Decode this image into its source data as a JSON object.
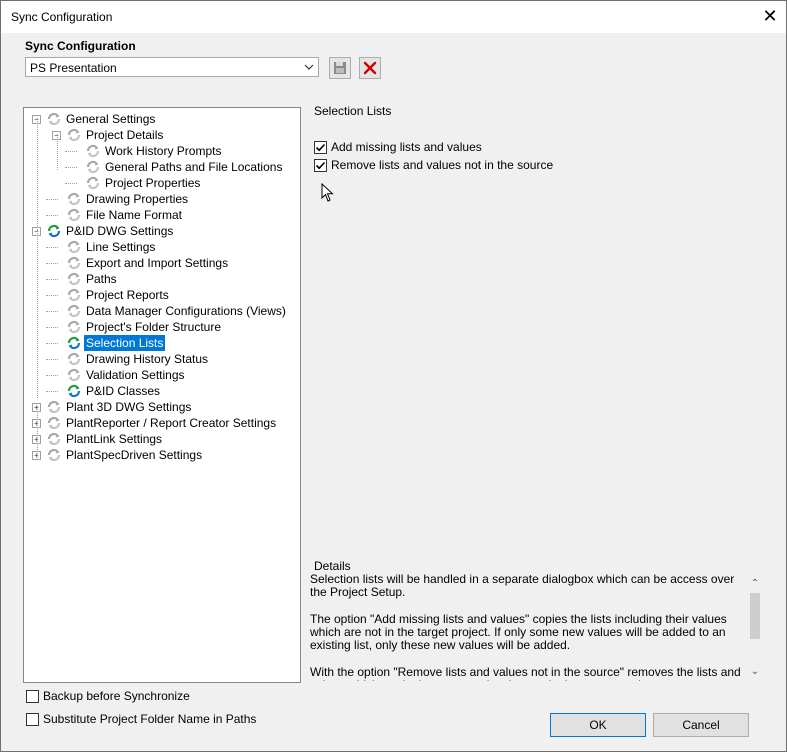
{
  "window": {
    "title": "Sync Configuration",
    "close": "✕"
  },
  "config": {
    "group_label": "Sync Configuration",
    "selected": "PS Presentation",
    "save_icon": "floppy-disk-icon",
    "delete_icon": "red-x-icon"
  },
  "tree": {
    "items": [
      {
        "label": "General Settings",
        "level": 0,
        "expander": "minus",
        "icon": "sync-gray"
      },
      {
        "label": "Project Details",
        "level": 1,
        "expander": "minus",
        "icon": "sync-gray"
      },
      {
        "label": "Work History Prompts",
        "level": 2,
        "expander": "none",
        "icon": "sync-gray"
      },
      {
        "label": "General Paths and File Locations",
        "level": 2,
        "expander": "none",
        "icon": "sync-gray"
      },
      {
        "label": "Project Properties",
        "level": 2,
        "expander": "none",
        "icon": "sync-gray"
      },
      {
        "label": "Drawing Properties",
        "level": 1,
        "expander": "none",
        "icon": "sync-gray"
      },
      {
        "label": "File Name Format",
        "level": 1,
        "expander": "none",
        "icon": "sync-gray"
      },
      {
        "label": "P&ID DWG Settings",
        "level": 0,
        "expander": "minus",
        "icon": "sync-color"
      },
      {
        "label": "Line Settings",
        "level": 1,
        "expander": "none",
        "icon": "sync-gray"
      },
      {
        "label": "Export and Import Settings",
        "level": 1,
        "expander": "none",
        "icon": "sync-gray"
      },
      {
        "label": "Paths",
        "level": 1,
        "expander": "none",
        "icon": "sync-gray"
      },
      {
        "label": "Project Reports",
        "level": 1,
        "expander": "none",
        "icon": "sync-gray"
      },
      {
        "label": "Data Manager Configurations (Views)",
        "level": 1,
        "expander": "none",
        "icon": "sync-gray"
      },
      {
        "label": "Project's Folder Structure",
        "level": 1,
        "expander": "none",
        "icon": "sync-gray"
      },
      {
        "label": "Selection Lists",
        "level": 1,
        "expander": "none",
        "icon": "sync-color",
        "selected": true
      },
      {
        "label": "Drawing History Status",
        "level": 1,
        "expander": "none",
        "icon": "sync-gray"
      },
      {
        "label": "Validation Settings",
        "level": 1,
        "expander": "none",
        "icon": "sync-gray"
      },
      {
        "label": "P&ID Classes",
        "level": 1,
        "expander": "none",
        "icon": "sync-color"
      },
      {
        "label": "Plant 3D DWG Settings",
        "level": 0,
        "expander": "plus",
        "icon": "sync-gray"
      },
      {
        "label": "PlantReporter / Report Creator Settings",
        "level": 0,
        "expander": "plus",
        "icon": "sync-gray"
      },
      {
        "label": "PlantLink Settings",
        "level": 0,
        "expander": "plus",
        "icon": "sync-gray"
      },
      {
        "label": "PlantSpecDriven Settings",
        "level": 0,
        "expander": "plus",
        "icon": "sync-gray"
      }
    ]
  },
  "panel": {
    "title": "Selection Lists",
    "options": [
      {
        "label": "Add missing lists and values",
        "checked": true
      },
      {
        "label": "Remove lists and values not in the source",
        "checked": true
      }
    ]
  },
  "details": {
    "title": "Details",
    "paragraphs": [
      "Selection lists will be handled in a separate dialogbox which can be access over the Project Setup.",
      "The option \"Add missing lists and values\" copies the lists including their values which are not in the target project. If only some new values will be added to an existing list, only these new values will be added.",
      "With the option \"Remove lists and values not in the source\" removes the lists and values which are in the target project but not in the source project."
    ]
  },
  "footer": {
    "backup_label": "Backup before Synchronize",
    "backup_checked": false,
    "substitute_label": "Substitute Project Folder Name in Paths",
    "substitute_checked": false,
    "ok": "OK",
    "cancel": "Cancel"
  }
}
